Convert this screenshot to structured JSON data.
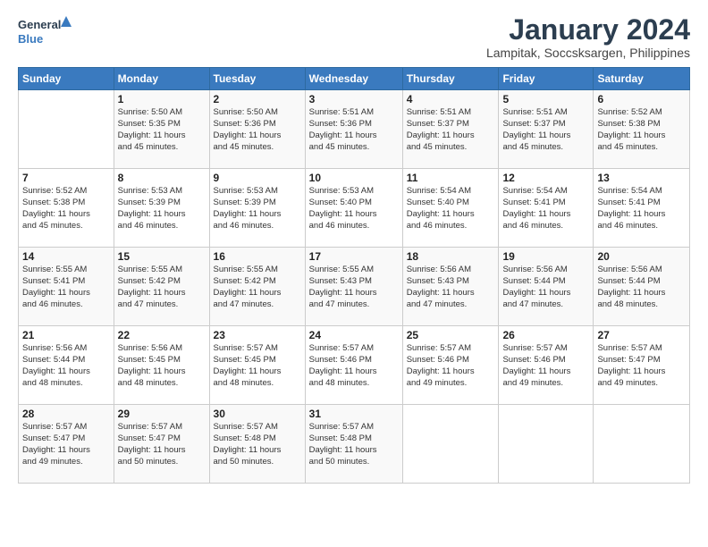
{
  "logo": {
    "text_general": "General",
    "text_blue": "Blue"
  },
  "header": {
    "month_title": "January 2024",
    "subtitle": "Lampitak, Soccsksargen, Philippines"
  },
  "days_of_week": [
    "Sunday",
    "Monday",
    "Tuesday",
    "Wednesday",
    "Thursday",
    "Friday",
    "Saturday"
  ],
  "weeks": [
    [
      {
        "day": "",
        "info": ""
      },
      {
        "day": "1",
        "info": "Sunrise: 5:50 AM\nSunset: 5:35 PM\nDaylight: 11 hours\nand 45 minutes."
      },
      {
        "day": "2",
        "info": "Sunrise: 5:50 AM\nSunset: 5:36 PM\nDaylight: 11 hours\nand 45 minutes."
      },
      {
        "day": "3",
        "info": "Sunrise: 5:51 AM\nSunset: 5:36 PM\nDaylight: 11 hours\nand 45 minutes."
      },
      {
        "day": "4",
        "info": "Sunrise: 5:51 AM\nSunset: 5:37 PM\nDaylight: 11 hours\nand 45 minutes."
      },
      {
        "day": "5",
        "info": "Sunrise: 5:51 AM\nSunset: 5:37 PM\nDaylight: 11 hours\nand 45 minutes."
      },
      {
        "day": "6",
        "info": "Sunrise: 5:52 AM\nSunset: 5:38 PM\nDaylight: 11 hours\nand 45 minutes."
      }
    ],
    [
      {
        "day": "7",
        "info": "Sunrise: 5:52 AM\nSunset: 5:38 PM\nDaylight: 11 hours\nand 45 minutes."
      },
      {
        "day": "8",
        "info": "Sunrise: 5:53 AM\nSunset: 5:39 PM\nDaylight: 11 hours\nand 46 minutes."
      },
      {
        "day": "9",
        "info": "Sunrise: 5:53 AM\nSunset: 5:39 PM\nDaylight: 11 hours\nand 46 minutes."
      },
      {
        "day": "10",
        "info": "Sunrise: 5:53 AM\nSunset: 5:40 PM\nDaylight: 11 hours\nand 46 minutes."
      },
      {
        "day": "11",
        "info": "Sunrise: 5:54 AM\nSunset: 5:40 PM\nDaylight: 11 hours\nand 46 minutes."
      },
      {
        "day": "12",
        "info": "Sunrise: 5:54 AM\nSunset: 5:41 PM\nDaylight: 11 hours\nand 46 minutes."
      },
      {
        "day": "13",
        "info": "Sunrise: 5:54 AM\nSunset: 5:41 PM\nDaylight: 11 hours\nand 46 minutes."
      }
    ],
    [
      {
        "day": "14",
        "info": "Sunrise: 5:55 AM\nSunset: 5:41 PM\nDaylight: 11 hours\nand 46 minutes."
      },
      {
        "day": "15",
        "info": "Sunrise: 5:55 AM\nSunset: 5:42 PM\nDaylight: 11 hours\nand 47 minutes."
      },
      {
        "day": "16",
        "info": "Sunrise: 5:55 AM\nSunset: 5:42 PM\nDaylight: 11 hours\nand 47 minutes."
      },
      {
        "day": "17",
        "info": "Sunrise: 5:55 AM\nSunset: 5:43 PM\nDaylight: 11 hours\nand 47 minutes."
      },
      {
        "day": "18",
        "info": "Sunrise: 5:56 AM\nSunset: 5:43 PM\nDaylight: 11 hours\nand 47 minutes."
      },
      {
        "day": "19",
        "info": "Sunrise: 5:56 AM\nSunset: 5:44 PM\nDaylight: 11 hours\nand 47 minutes."
      },
      {
        "day": "20",
        "info": "Sunrise: 5:56 AM\nSunset: 5:44 PM\nDaylight: 11 hours\nand 48 minutes."
      }
    ],
    [
      {
        "day": "21",
        "info": "Sunrise: 5:56 AM\nSunset: 5:44 PM\nDaylight: 11 hours\nand 48 minutes."
      },
      {
        "day": "22",
        "info": "Sunrise: 5:56 AM\nSunset: 5:45 PM\nDaylight: 11 hours\nand 48 minutes."
      },
      {
        "day": "23",
        "info": "Sunrise: 5:57 AM\nSunset: 5:45 PM\nDaylight: 11 hours\nand 48 minutes."
      },
      {
        "day": "24",
        "info": "Sunrise: 5:57 AM\nSunset: 5:46 PM\nDaylight: 11 hours\nand 48 minutes."
      },
      {
        "day": "25",
        "info": "Sunrise: 5:57 AM\nSunset: 5:46 PM\nDaylight: 11 hours\nand 49 minutes."
      },
      {
        "day": "26",
        "info": "Sunrise: 5:57 AM\nSunset: 5:46 PM\nDaylight: 11 hours\nand 49 minutes."
      },
      {
        "day": "27",
        "info": "Sunrise: 5:57 AM\nSunset: 5:47 PM\nDaylight: 11 hours\nand 49 minutes."
      }
    ],
    [
      {
        "day": "28",
        "info": "Sunrise: 5:57 AM\nSunset: 5:47 PM\nDaylight: 11 hours\nand 49 minutes."
      },
      {
        "day": "29",
        "info": "Sunrise: 5:57 AM\nSunset: 5:47 PM\nDaylight: 11 hours\nand 50 minutes."
      },
      {
        "day": "30",
        "info": "Sunrise: 5:57 AM\nSunset: 5:48 PM\nDaylight: 11 hours\nand 50 minutes."
      },
      {
        "day": "31",
        "info": "Sunrise: 5:57 AM\nSunset: 5:48 PM\nDaylight: 11 hours\nand 50 minutes."
      },
      {
        "day": "",
        "info": ""
      },
      {
        "day": "",
        "info": ""
      },
      {
        "day": "",
        "info": ""
      }
    ]
  ]
}
